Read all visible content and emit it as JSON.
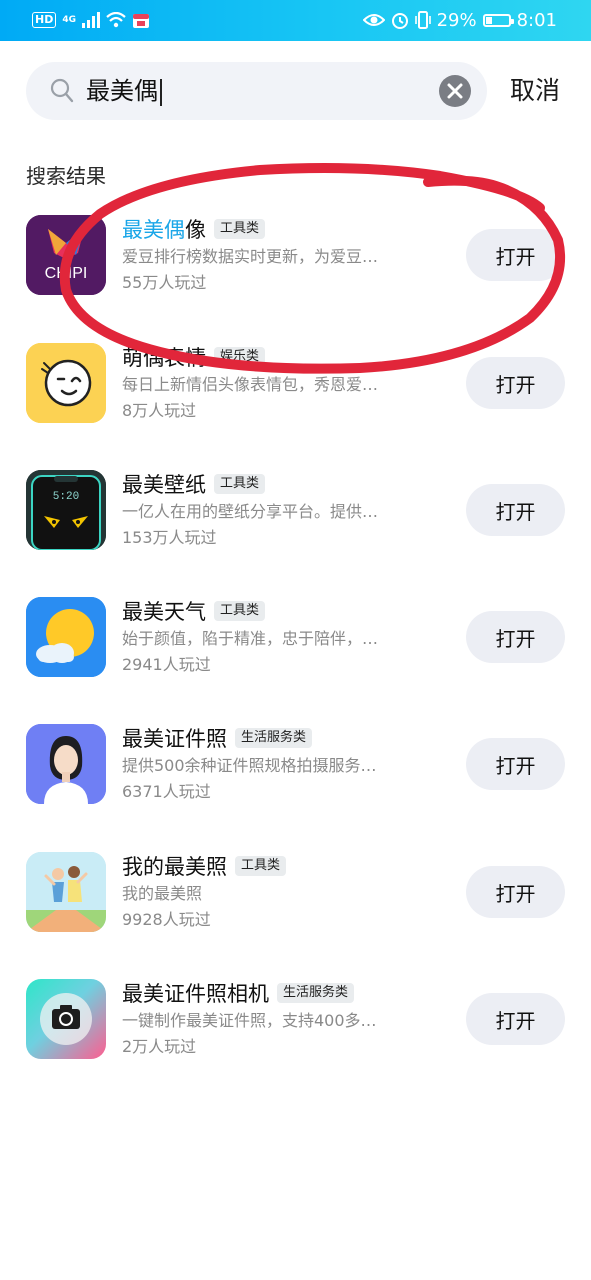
{
  "status_bar": {
    "hd": "HD",
    "network": "4G",
    "battery_percent": "29%",
    "battery_level": 0.29,
    "time": "8:01"
  },
  "search": {
    "query": "最美偶",
    "cancel_label": "取消",
    "icons": [
      "search-icon",
      "clear-icon"
    ]
  },
  "section_title": "搜索结果",
  "annotation_color": "#e1263a",
  "accent_color": "#1aa6e8",
  "results": [
    {
      "title_hl": "最美偶",
      "title_rest": "像",
      "tag": "工具类",
      "desc": "爱豆排行榜数据实时更新，为爱豆…",
      "plays": "55万人玩过",
      "button": "打开",
      "icon_text": "CHIPI"
    },
    {
      "title_hl": "",
      "title_rest": "萌偶表情",
      "tag": "娱乐类",
      "desc": "每日上新情侣头像表情包，秀恩爱…",
      "plays": "8万人玩过",
      "button": "打开"
    },
    {
      "title_hl": "",
      "title_rest": "最美壁纸",
      "tag": "工具类",
      "desc": "一亿人在用的壁纸分享平台。提供…",
      "plays": "153万人玩过",
      "button": "打开",
      "icon_text": "5:20"
    },
    {
      "title_hl": "",
      "title_rest": "最美天气",
      "tag": "工具类",
      "desc": "始于颜值，陷于精准，忠于陪伴，…",
      "plays": "2941人玩过",
      "button": "打开"
    },
    {
      "title_hl": "",
      "title_rest": "最美证件照",
      "tag": "生活服务类",
      "desc": "提供500余种证件照规格拍摄服务…",
      "plays": "6371人玩过",
      "button": "打开"
    },
    {
      "title_hl": "",
      "title_rest": "我的最美照",
      "tag": "工具类",
      "desc": "我的最美照",
      "plays": "9928人玩过",
      "button": "打开"
    },
    {
      "title_hl": "",
      "title_rest": "最美证件照相机",
      "tag": "生活服务类",
      "desc": "一键制作最美证件照，支持400多…",
      "plays": "2万人玩过",
      "button": "打开"
    }
  ]
}
